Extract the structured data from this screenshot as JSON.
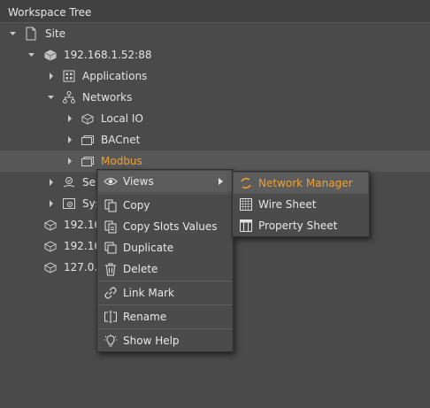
{
  "panel": {
    "title": "Workspace Tree"
  },
  "tree": {
    "site": "Site",
    "station": "192.168.1.52:88",
    "applications": "Applications",
    "networks": "Networks",
    "local_io": "Local IO",
    "bacnet": "BACnet",
    "modbus": "Modbus",
    "services_partial": "Ser",
    "system_partial": "Sys",
    "station2_partial": "192.16",
    "station3_partial": "192.16",
    "station4_partial": "127.0.0"
  },
  "context_menu": {
    "views": "Views",
    "copy": "Copy",
    "copy_slots_values": "Copy Slots Values",
    "duplicate": "Duplicate",
    "delete": "Delete",
    "link_mark": "Link Mark",
    "rename": "Rename",
    "show_help": "Show Help"
  },
  "submenu": {
    "network_manager": "Network Manager",
    "wire_sheet": "Wire Sheet",
    "property_sheet": "Property Sheet"
  },
  "colors": {
    "accent": "#f0a030",
    "background": "#4a4a4a",
    "selection": "#575757"
  }
}
